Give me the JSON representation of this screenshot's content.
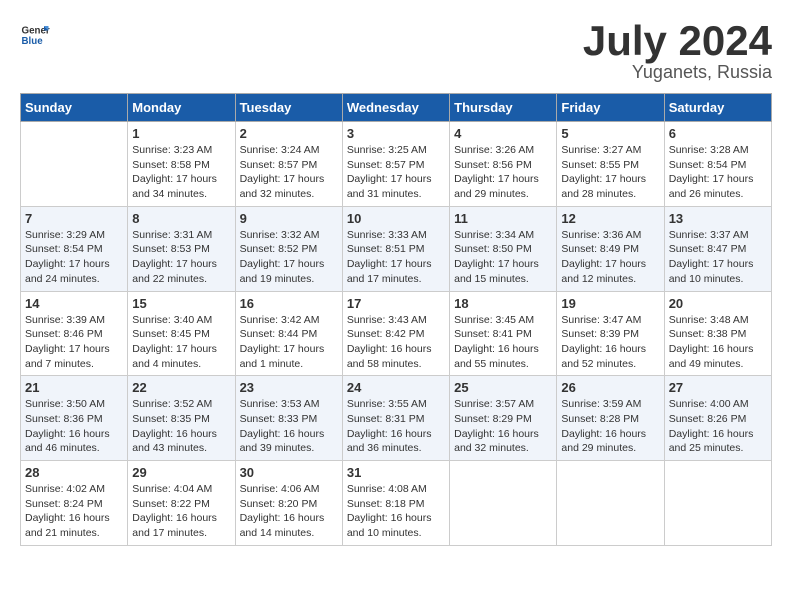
{
  "header": {
    "logo_general": "General",
    "logo_blue": "Blue",
    "month_year": "July 2024",
    "location": "Yuganets, Russia"
  },
  "days_of_week": [
    "Sunday",
    "Monday",
    "Tuesday",
    "Wednesday",
    "Thursday",
    "Friday",
    "Saturday"
  ],
  "weeks": [
    [
      {
        "day": "",
        "sunrise": "",
        "sunset": "",
        "daylight": ""
      },
      {
        "day": "1",
        "sunrise": "Sunrise: 3:23 AM",
        "sunset": "Sunset: 8:58 PM",
        "daylight": "Daylight: 17 hours and 34 minutes."
      },
      {
        "day": "2",
        "sunrise": "Sunrise: 3:24 AM",
        "sunset": "Sunset: 8:57 PM",
        "daylight": "Daylight: 17 hours and 32 minutes."
      },
      {
        "day": "3",
        "sunrise": "Sunrise: 3:25 AM",
        "sunset": "Sunset: 8:57 PM",
        "daylight": "Daylight: 17 hours and 31 minutes."
      },
      {
        "day": "4",
        "sunrise": "Sunrise: 3:26 AM",
        "sunset": "Sunset: 8:56 PM",
        "daylight": "Daylight: 17 hours and 29 minutes."
      },
      {
        "day": "5",
        "sunrise": "Sunrise: 3:27 AM",
        "sunset": "Sunset: 8:55 PM",
        "daylight": "Daylight: 17 hours and 28 minutes."
      },
      {
        "day": "6",
        "sunrise": "Sunrise: 3:28 AM",
        "sunset": "Sunset: 8:54 PM",
        "daylight": "Daylight: 17 hours and 26 minutes."
      }
    ],
    [
      {
        "day": "7",
        "sunrise": "Sunrise: 3:29 AM",
        "sunset": "Sunset: 8:54 PM",
        "daylight": "Daylight: 17 hours and 24 minutes."
      },
      {
        "day": "8",
        "sunrise": "Sunrise: 3:31 AM",
        "sunset": "Sunset: 8:53 PM",
        "daylight": "Daylight: 17 hours and 22 minutes."
      },
      {
        "day": "9",
        "sunrise": "Sunrise: 3:32 AM",
        "sunset": "Sunset: 8:52 PM",
        "daylight": "Daylight: 17 hours and 19 minutes."
      },
      {
        "day": "10",
        "sunrise": "Sunrise: 3:33 AM",
        "sunset": "Sunset: 8:51 PM",
        "daylight": "Daylight: 17 hours and 17 minutes."
      },
      {
        "day": "11",
        "sunrise": "Sunrise: 3:34 AM",
        "sunset": "Sunset: 8:50 PM",
        "daylight": "Daylight: 17 hours and 15 minutes."
      },
      {
        "day": "12",
        "sunrise": "Sunrise: 3:36 AM",
        "sunset": "Sunset: 8:49 PM",
        "daylight": "Daylight: 17 hours and 12 minutes."
      },
      {
        "day": "13",
        "sunrise": "Sunrise: 3:37 AM",
        "sunset": "Sunset: 8:47 PM",
        "daylight": "Daylight: 17 hours and 10 minutes."
      }
    ],
    [
      {
        "day": "14",
        "sunrise": "Sunrise: 3:39 AM",
        "sunset": "Sunset: 8:46 PM",
        "daylight": "Daylight: 17 hours and 7 minutes."
      },
      {
        "day": "15",
        "sunrise": "Sunrise: 3:40 AM",
        "sunset": "Sunset: 8:45 PM",
        "daylight": "Daylight: 17 hours and 4 minutes."
      },
      {
        "day": "16",
        "sunrise": "Sunrise: 3:42 AM",
        "sunset": "Sunset: 8:44 PM",
        "daylight": "Daylight: 17 hours and 1 minute."
      },
      {
        "day": "17",
        "sunrise": "Sunrise: 3:43 AM",
        "sunset": "Sunset: 8:42 PM",
        "daylight": "Daylight: 16 hours and 58 minutes."
      },
      {
        "day": "18",
        "sunrise": "Sunrise: 3:45 AM",
        "sunset": "Sunset: 8:41 PM",
        "daylight": "Daylight: 16 hours and 55 minutes."
      },
      {
        "day": "19",
        "sunrise": "Sunrise: 3:47 AM",
        "sunset": "Sunset: 8:39 PM",
        "daylight": "Daylight: 16 hours and 52 minutes."
      },
      {
        "day": "20",
        "sunrise": "Sunrise: 3:48 AM",
        "sunset": "Sunset: 8:38 PM",
        "daylight": "Daylight: 16 hours and 49 minutes."
      }
    ],
    [
      {
        "day": "21",
        "sunrise": "Sunrise: 3:50 AM",
        "sunset": "Sunset: 8:36 PM",
        "daylight": "Daylight: 16 hours and 46 minutes."
      },
      {
        "day": "22",
        "sunrise": "Sunrise: 3:52 AM",
        "sunset": "Sunset: 8:35 PM",
        "daylight": "Daylight: 16 hours and 43 minutes."
      },
      {
        "day": "23",
        "sunrise": "Sunrise: 3:53 AM",
        "sunset": "Sunset: 8:33 PM",
        "daylight": "Daylight: 16 hours and 39 minutes."
      },
      {
        "day": "24",
        "sunrise": "Sunrise: 3:55 AM",
        "sunset": "Sunset: 8:31 PM",
        "daylight": "Daylight: 16 hours and 36 minutes."
      },
      {
        "day": "25",
        "sunrise": "Sunrise: 3:57 AM",
        "sunset": "Sunset: 8:29 PM",
        "daylight": "Daylight: 16 hours and 32 minutes."
      },
      {
        "day": "26",
        "sunrise": "Sunrise: 3:59 AM",
        "sunset": "Sunset: 8:28 PM",
        "daylight": "Daylight: 16 hours and 29 minutes."
      },
      {
        "day": "27",
        "sunrise": "Sunrise: 4:00 AM",
        "sunset": "Sunset: 8:26 PM",
        "daylight": "Daylight: 16 hours and 25 minutes."
      }
    ],
    [
      {
        "day": "28",
        "sunrise": "Sunrise: 4:02 AM",
        "sunset": "Sunset: 8:24 PM",
        "daylight": "Daylight: 16 hours and 21 minutes."
      },
      {
        "day": "29",
        "sunrise": "Sunrise: 4:04 AM",
        "sunset": "Sunset: 8:22 PM",
        "daylight": "Daylight: 16 hours and 17 minutes."
      },
      {
        "day": "30",
        "sunrise": "Sunrise: 4:06 AM",
        "sunset": "Sunset: 8:20 PM",
        "daylight": "Daylight: 16 hours and 14 minutes."
      },
      {
        "day": "31",
        "sunrise": "Sunrise: 4:08 AM",
        "sunset": "Sunset: 8:18 PM",
        "daylight": "Daylight: 16 hours and 10 minutes."
      },
      {
        "day": "",
        "sunrise": "",
        "sunset": "",
        "daylight": ""
      },
      {
        "day": "",
        "sunrise": "",
        "sunset": "",
        "daylight": ""
      },
      {
        "day": "",
        "sunrise": "",
        "sunset": "",
        "daylight": ""
      }
    ]
  ]
}
